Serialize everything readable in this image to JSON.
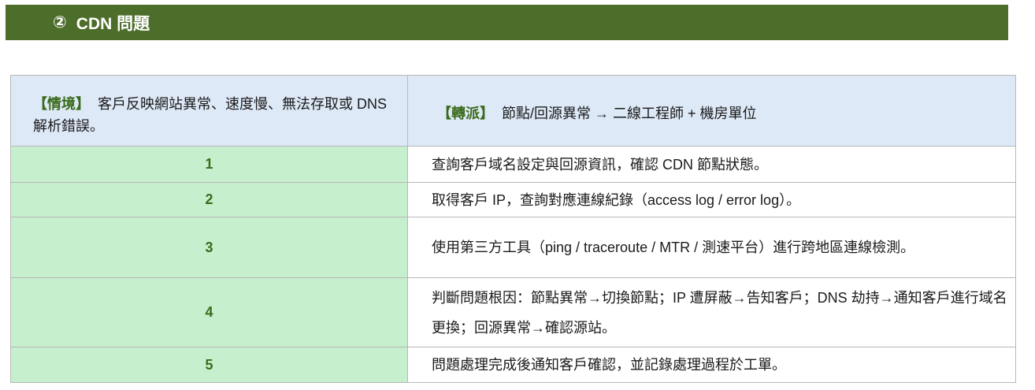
{
  "header": {
    "number": "②",
    "title": "CDN 問題"
  },
  "info": {
    "situation_tag": "【情境】",
    "situation_text": "客戶反映網站異常、速度慢、無法存取或 DNS 解析錯誤。",
    "dispatch_tag": "【轉派】",
    "dispatch_text": "節點/回源異常 → 二線工程師 + 機房單位"
  },
  "steps": [
    {
      "num": "1",
      "text": "查詢客戶域名設定與回源資訊，確認 CDN 節點狀態。"
    },
    {
      "num": "2",
      "text": "取得客戶 IP，查詢對應連線紀錄（access log / error log）。"
    },
    {
      "num": "3",
      "text": "使用第三方工具（ping / traceroute / MTR / 測速平台）進行跨地區連線檢測。"
    },
    {
      "num": "4",
      "text": "判斷問題根因：節點異常→切換節點；IP 遭屏蔽→告知客戶；DNS 劫持→通知客戶進行域名更換；回源異常→確認源站。"
    },
    {
      "num": "5",
      "text": "問題處理完成後通知客戶確認，並記錄處理過程於工單。"
    }
  ],
  "colors": {
    "header_bg": "#4d6d2a",
    "info_bg": "#dee9f7",
    "step_bg": "#c6efce",
    "tag_color": "#3a6b1c"
  }
}
